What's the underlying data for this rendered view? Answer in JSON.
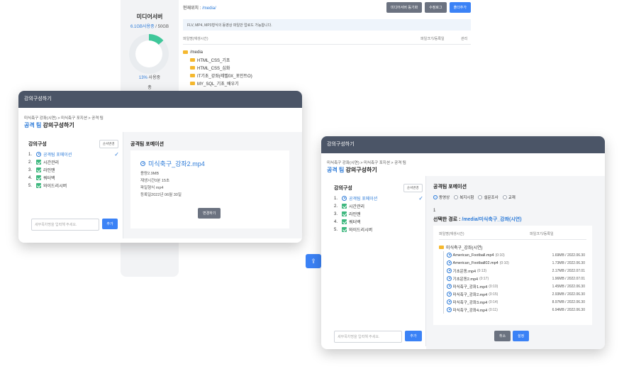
{
  "colors": {
    "accent": "#2d7bd8",
    "primary_button": "#3b82f6",
    "secondary_button": "#6b7280",
    "modal_header": "#4b5567",
    "folder": "#f5b82e",
    "check_icon": "#3fb87f",
    "storage_ring": "#3fc79a"
  },
  "storage": {
    "title": "미디어서버",
    "used": "6.1GB사용중",
    "separator": " / ",
    "total": "50GB",
    "used_percent": 13,
    "percent_label": "13%",
    "percent_suffix": " 사용중",
    "more": "총"
  },
  "file_manager": {
    "path_label": "현재위치 : ",
    "path_value": "/media/",
    "buttons": {
      "sync": "미디어서버 동기화",
      "log": "수정로그",
      "upload": "폴더추가"
    },
    "notice": "FLV, MP4, MP3형식의 동영상 파일만 업로드 가능합니다.",
    "columns": {
      "name": "파일명(재생시간)",
      "size": "파일크기/등록일",
      "manage": "관리"
    },
    "root": "/media",
    "folders": [
      "HTML_CSS_기초",
      "HTML_CSS_심화",
      "IT기초_강좌(레벨0X_포인트O)",
      "MY_SQL_기초_배우기"
    ]
  },
  "modal_a": {
    "header": "강의구성하기",
    "breadcrumb": "미식축구 강좌(시연) > 미식축구 포지션 > 공격 팀",
    "title_highlight": "공격 팀",
    "title_rest": " 강의구성하기",
    "list_title": "강의구성",
    "order_button": "순서변경",
    "items": [
      {
        "num": "1.",
        "label": "공격팀 포메이션",
        "icon": "play-icon"
      },
      {
        "num": "2.",
        "label": "시간관리",
        "icon": "check-square-icon"
      },
      {
        "num": "3.",
        "label": "라인맨",
        "icon": "check-square-icon"
      },
      {
        "num": "4.",
        "label": "쿼터백",
        "icon": "check-square-icon"
      },
      {
        "num": "5.",
        "label": "와이드리시버",
        "icon": "check-square-icon"
      }
    ],
    "input_placeholder": "세부목차명을 입력해 주세요.",
    "add_button": "추가",
    "section_title": "공격팀 포메이션",
    "file_name": "미식축구_강좌2.mp4",
    "meta": [
      "용량2.9MB",
      "재생시간0분 15초",
      "파일형식 mp4",
      "등록일2022년 06월 30일"
    ],
    "change_button": "변경하기"
  },
  "modal_b": {
    "header": "강의구성하기",
    "breadcrumb": "미식축구 강좌(시연) > 미식축구 포지션 > 공격 팀",
    "title_highlight": "공격 팀",
    "title_rest": " 강의구성하기",
    "list_title": "강의구성",
    "order_button": "순서변경",
    "items": [
      {
        "num": "1.",
        "label": "공격팀 포메이션",
        "icon": "play-icon"
      },
      {
        "num": "2.",
        "label": "시간관리",
        "icon": "check-square-icon"
      },
      {
        "num": "3.",
        "label": "라인맨",
        "icon": "check-square-icon"
      },
      {
        "num": "4.",
        "label": "쿼터백",
        "icon": "check-square-icon"
      },
      {
        "num": "5.",
        "label": "와이드리시버",
        "icon": "check-square-icon"
      }
    ],
    "input_placeholder": "세부목차명을 입력해 주세요.",
    "add_button": "추가",
    "section_title": "공격팀 포메이션",
    "radio_options": [
      "동영상",
      "복지시험",
      "설문조사",
      "교재"
    ],
    "radio_selected": "동영상",
    "step": "1",
    "selected_path_label": "선택한 경로 : ",
    "selected_path_value": "/media/미식축구_강좌(시연)",
    "columns": {
      "name": "파일명(재생시간)",
      "size": "파일크기/등록일"
    },
    "folder": "미식축구_강좌(시연)",
    "files": [
      {
        "name": "American_Football.mp4",
        "dur": "(0:10)",
        "size": "1.69MB / 2022.06.30"
      },
      {
        "name": "American_Football02.mp4",
        "dur": "(0:10)",
        "size": "1.73MB / 2022.06.30"
      },
      {
        "name": "기초운동.mp4",
        "dur": "(0:13)",
        "size": "2.17MB / 2022.07.01"
      },
      {
        "name": "기초운동2.mp4",
        "dur": "(0:17)",
        "size": "1.96MB / 2022.07.01"
      },
      {
        "name": "미식축구_강좌1.mp4",
        "dur": "(0:10)",
        "size": "1.45MB / 2022.06.30"
      },
      {
        "name": "미식축구_강좌2.mp4",
        "dur": "(0:15)",
        "size": "2.93MB / 2022.06.30"
      },
      {
        "name": "미식축구_강좌3.mp4",
        "dur": "(0:14)",
        "size": "8.97MB / 2022.06.30"
      },
      {
        "name": "미식축구_강좌4.mp4",
        "dur": "(0:11)",
        "size": "6.94MB / 2022.06.30"
      }
    ],
    "cancel_button": "취소",
    "confirm_button": "설정"
  },
  "floating_button": {
    "icon": "upload-icon",
    "glyph": "⇪"
  }
}
